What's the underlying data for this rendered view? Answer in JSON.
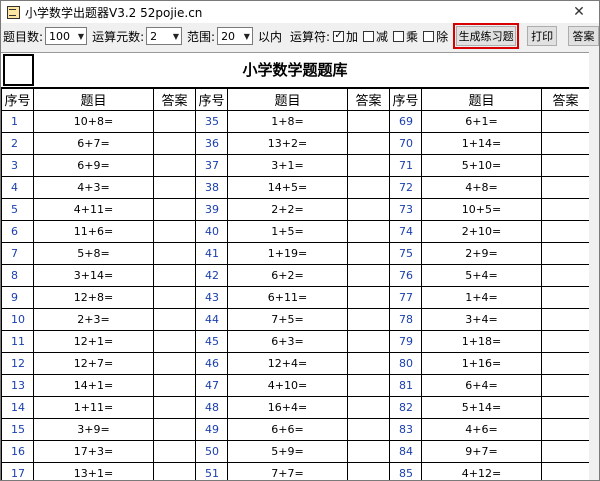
{
  "window": {
    "title": "小学数学出题器V3.2 52pojie.cn",
    "close_glyph": "✕"
  },
  "toolbar": {
    "count_label": "题目数:",
    "count_value": "100",
    "operands_label": "运算元数:",
    "operands_value": "2",
    "range_label": "范围:",
    "range_value": "20",
    "range_suffix": "以内",
    "ops_label": "运算符:",
    "ops": [
      {
        "label": "加",
        "checked": true,
        "glyph": "✓"
      },
      {
        "label": "减",
        "checked": false,
        "glyph": ""
      },
      {
        "label": "乘",
        "checked": false,
        "glyph": ""
      },
      {
        "label": "除",
        "checked": false,
        "glyph": ""
      }
    ],
    "generate_label": "生成练习题",
    "print_label": "打印",
    "answer_label": "答案",
    "accent_color": "#d60000"
  },
  "sheet": {
    "title": "小学数学题题库",
    "headers": [
      "序号",
      "题目",
      "答案",
      "序号",
      "题目",
      "答案",
      "序号",
      "题目",
      "答案"
    ],
    "rows": [
      [
        [
          "1",
          "10+8="
        ],
        [
          "35",
          "1+8="
        ],
        [
          "69",
          "6+1="
        ]
      ],
      [
        [
          "2",
          "6+7="
        ],
        [
          "36",
          "13+2="
        ],
        [
          "70",
          "1+14="
        ]
      ],
      [
        [
          "3",
          "6+9="
        ],
        [
          "37",
          "3+1="
        ],
        [
          "71",
          "5+10="
        ]
      ],
      [
        [
          "4",
          "4+3="
        ],
        [
          "38",
          "14+5="
        ],
        [
          "72",
          "4+8="
        ]
      ],
      [
        [
          "5",
          "4+11="
        ],
        [
          "39",
          "2+2="
        ],
        [
          "73",
          "10+5="
        ]
      ],
      [
        [
          "6",
          "11+6="
        ],
        [
          "40",
          "1+5="
        ],
        [
          "74",
          "2+10="
        ]
      ],
      [
        [
          "7",
          "5+8="
        ],
        [
          "41",
          "1+19="
        ],
        [
          "75",
          "2+9="
        ]
      ],
      [
        [
          "8",
          "3+14="
        ],
        [
          "42",
          "6+2="
        ],
        [
          "76",
          "5+4="
        ]
      ],
      [
        [
          "9",
          "12+8="
        ],
        [
          "43",
          "6+11="
        ],
        [
          "77",
          "1+4="
        ]
      ],
      [
        [
          "10",
          "2+3="
        ],
        [
          "44",
          "7+5="
        ],
        [
          "78",
          "3+4="
        ]
      ],
      [
        [
          "11",
          "12+1="
        ],
        [
          "45",
          "6+3="
        ],
        [
          "79",
          "1+18="
        ]
      ],
      [
        [
          "12",
          "12+7="
        ],
        [
          "46",
          "12+4="
        ],
        [
          "80",
          "1+16="
        ]
      ],
      [
        [
          "13",
          "14+1="
        ],
        [
          "47",
          "4+10="
        ],
        [
          "81",
          "6+4="
        ]
      ],
      [
        [
          "14",
          "1+11="
        ],
        [
          "48",
          "16+4="
        ],
        [
          "82",
          "5+14="
        ]
      ],
      [
        [
          "15",
          "3+9="
        ],
        [
          "49",
          "6+6="
        ],
        [
          "83",
          "4+6="
        ]
      ],
      [
        [
          "16",
          "17+3="
        ],
        [
          "50",
          "5+9="
        ],
        [
          "84",
          "9+7="
        ]
      ],
      [
        [
          "17",
          "13+1="
        ],
        [
          "51",
          "7+7="
        ],
        [
          "85",
          "4+12="
        ]
      ]
    ]
  }
}
